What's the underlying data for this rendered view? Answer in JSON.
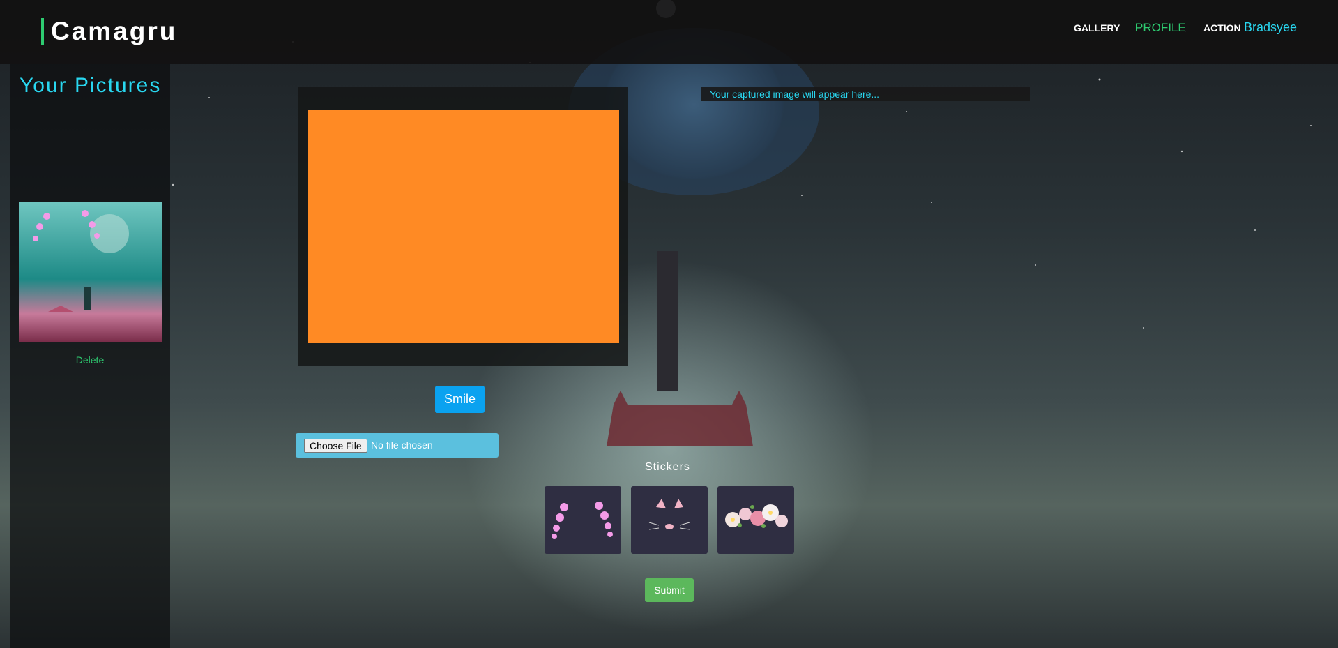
{
  "navbar": {
    "brand": "Camagru",
    "links": [
      {
        "label": "GALLERY"
      },
      {
        "label": "PROFILE"
      },
      {
        "label": "ACTION"
      }
    ],
    "username": "Bradsyee"
  },
  "sidebar": {
    "title": "Your Pictures",
    "pictures": [
      {
        "delete_label": "Delete"
      }
    ]
  },
  "main": {
    "preview_text": "Your captured image will appear here...",
    "smile_label": "Smile",
    "file_input": {
      "button_label": "Choose File",
      "status": "No file chosen"
    },
    "stickers_title": "Stickers",
    "stickers": [
      {
        "icon": "cherry-blossom-frame-icon"
      },
      {
        "icon": "cat-ears-icon"
      },
      {
        "icon": "flower-crown-icon"
      }
    ],
    "submit_label": "Submit"
  },
  "colors": {
    "accent_green": "#2ecc71",
    "accent_cyan": "#29d7f0",
    "camera_placeholder": "#ff8a24",
    "smile_button": "#0aa2f0",
    "submit_button": "#5cb85c",
    "file_box": "#5bc0de"
  }
}
